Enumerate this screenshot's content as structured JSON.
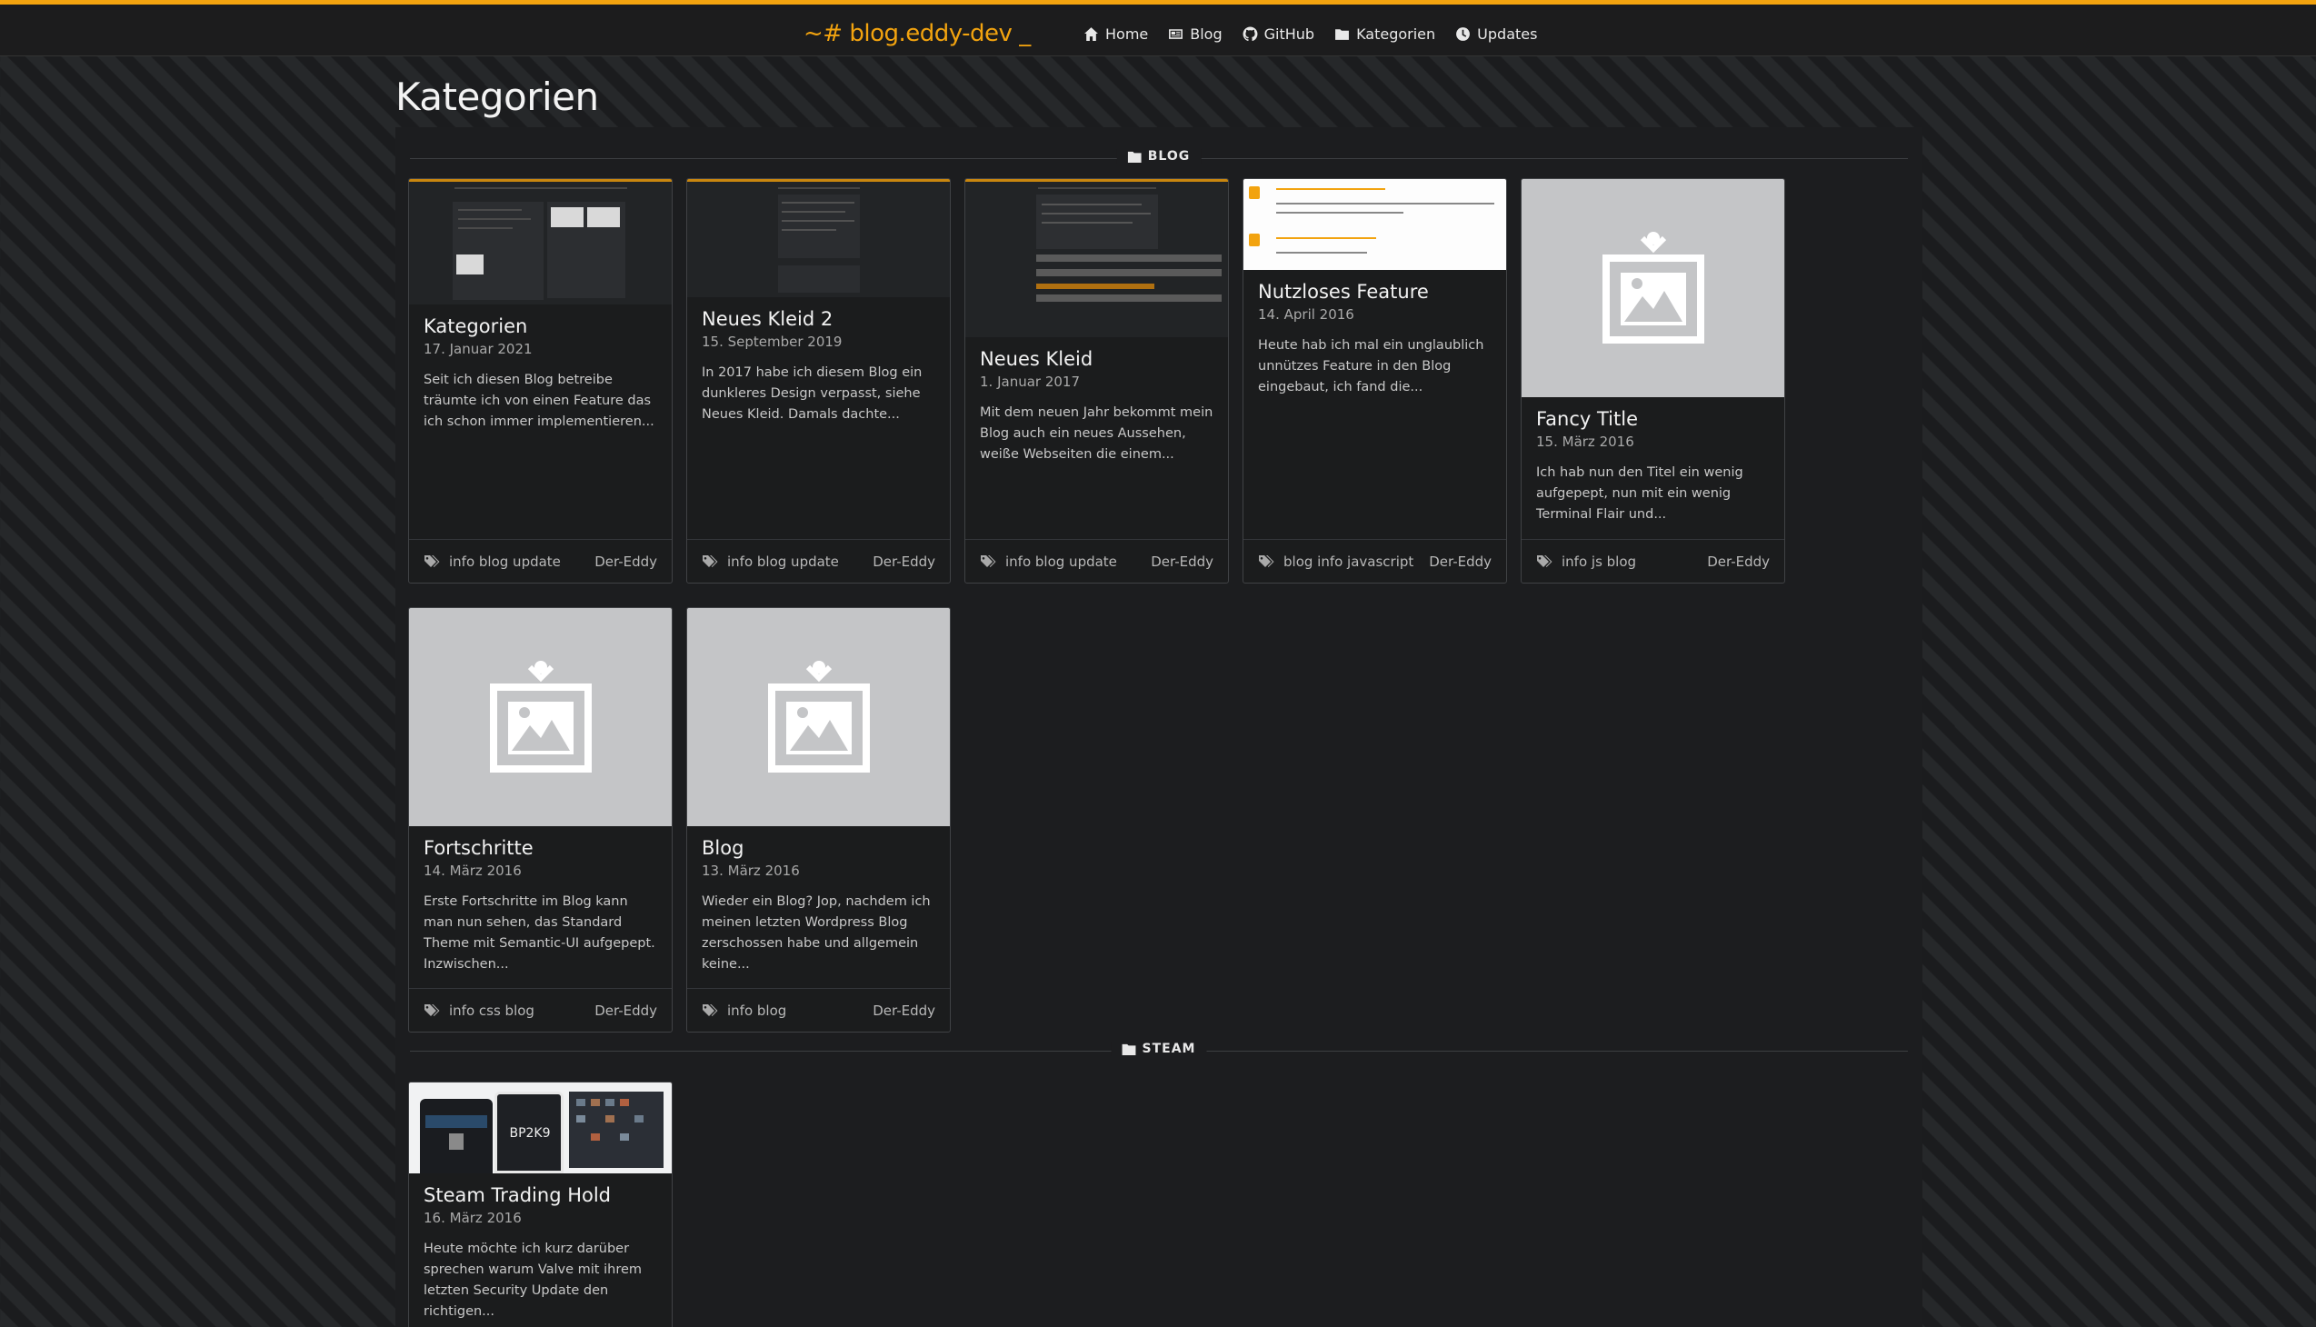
{
  "header": {
    "brand": "~# blog.eddy-dev _",
    "nav": [
      {
        "label": "Home",
        "icon": "home-icon"
      },
      {
        "label": "Blog",
        "icon": "newspaper-icon"
      },
      {
        "label": "GitHub",
        "icon": "github-icon"
      },
      {
        "label": "Kategorien",
        "icon": "folder-icon"
      },
      {
        "label": "Updates",
        "icon": "clock-icon"
      }
    ]
  },
  "page": {
    "title": "Kategorien"
  },
  "sections": [
    {
      "name": "BLOG",
      "icon": "folder-icon",
      "cards": [
        {
          "title": "Kategorien",
          "date": "17. Januar 2021",
          "excerpt": "Seit ich diesen Blog betreibe träumte ich von einen Feature das ich schon immer implementieren...",
          "tags": "info blog update",
          "author": "Der-Eddy",
          "thumb": "screenshot-dark"
        },
        {
          "title": "Neues Kleid 2",
          "date": "15. September 2019",
          "excerpt": "In 2017 habe ich diesem Blog ein dunkleres Design verpasst, siehe Neues Kleid. Damals dachte...",
          "tags": "info blog update",
          "author": "Der-Eddy",
          "thumb": "screenshot-dark"
        },
        {
          "title": "Neues Kleid",
          "date": "1. Januar 2017",
          "excerpt": "Mit dem neuen Jahr bekommt mein Blog auch ein neues Aussehen, weiße Webseiten die einem...",
          "tags": "info blog update",
          "author": "Der-Eddy",
          "thumb": "screenshot-dark"
        },
        {
          "title": "Nutzloses Feature",
          "date": "14. April 2016",
          "excerpt": "Heute hab ich mal ein unglaublich unnützes Feature in den Blog eingebaut, ich fand die...",
          "tags": "blog info javascript",
          "author": "Der-Eddy",
          "thumb": "screenshot-light"
        },
        {
          "title": "Fancy Title",
          "date": "15. März 2016",
          "excerpt": "Ich hab nun den Titel ein wenig aufgepept, nun mit ein wenig Terminal Flair und...",
          "tags": "info js blog",
          "author": "Der-Eddy",
          "thumb": "placeholder-image-icon"
        },
        {
          "title": "Fortschritte",
          "date": "14. März 2016",
          "excerpt": "Erste Fortschritte im Blog kann man nun sehen, das Standard Theme mit Semantic-UI aufgepept. Inzwischen...",
          "tags": "info css blog",
          "author": "Der-Eddy",
          "thumb": "placeholder-image-icon"
        },
        {
          "title": "Blog",
          "date": "13. März 2016",
          "excerpt": "Wieder ein Blog? Jop, nachdem ich meinen letzten Wordpress Blog zerschossen habe und allgemein keine...",
          "tags": "info blog",
          "author": "Der-Eddy",
          "thumb": "placeholder-image-icon"
        }
      ]
    },
    {
      "name": "STEAM",
      "icon": "folder-icon",
      "cards": [
        {
          "title": "Steam Trading Hold",
          "date": "16. März 2016",
          "excerpt": "Heute möchte ich kurz darüber sprechen warum Valve mit ihrem letzten Security Update den richtigen...",
          "tags": "",
          "author": "",
          "thumb": "screenshot-phones",
          "thumb_text": "BP2K9"
        }
      ]
    }
  ],
  "colors": {
    "accent": "#f2a30f",
    "background": "#1a1b1c",
    "card": "#1b1c1d",
    "placeholder": "#c4c5c7"
  }
}
